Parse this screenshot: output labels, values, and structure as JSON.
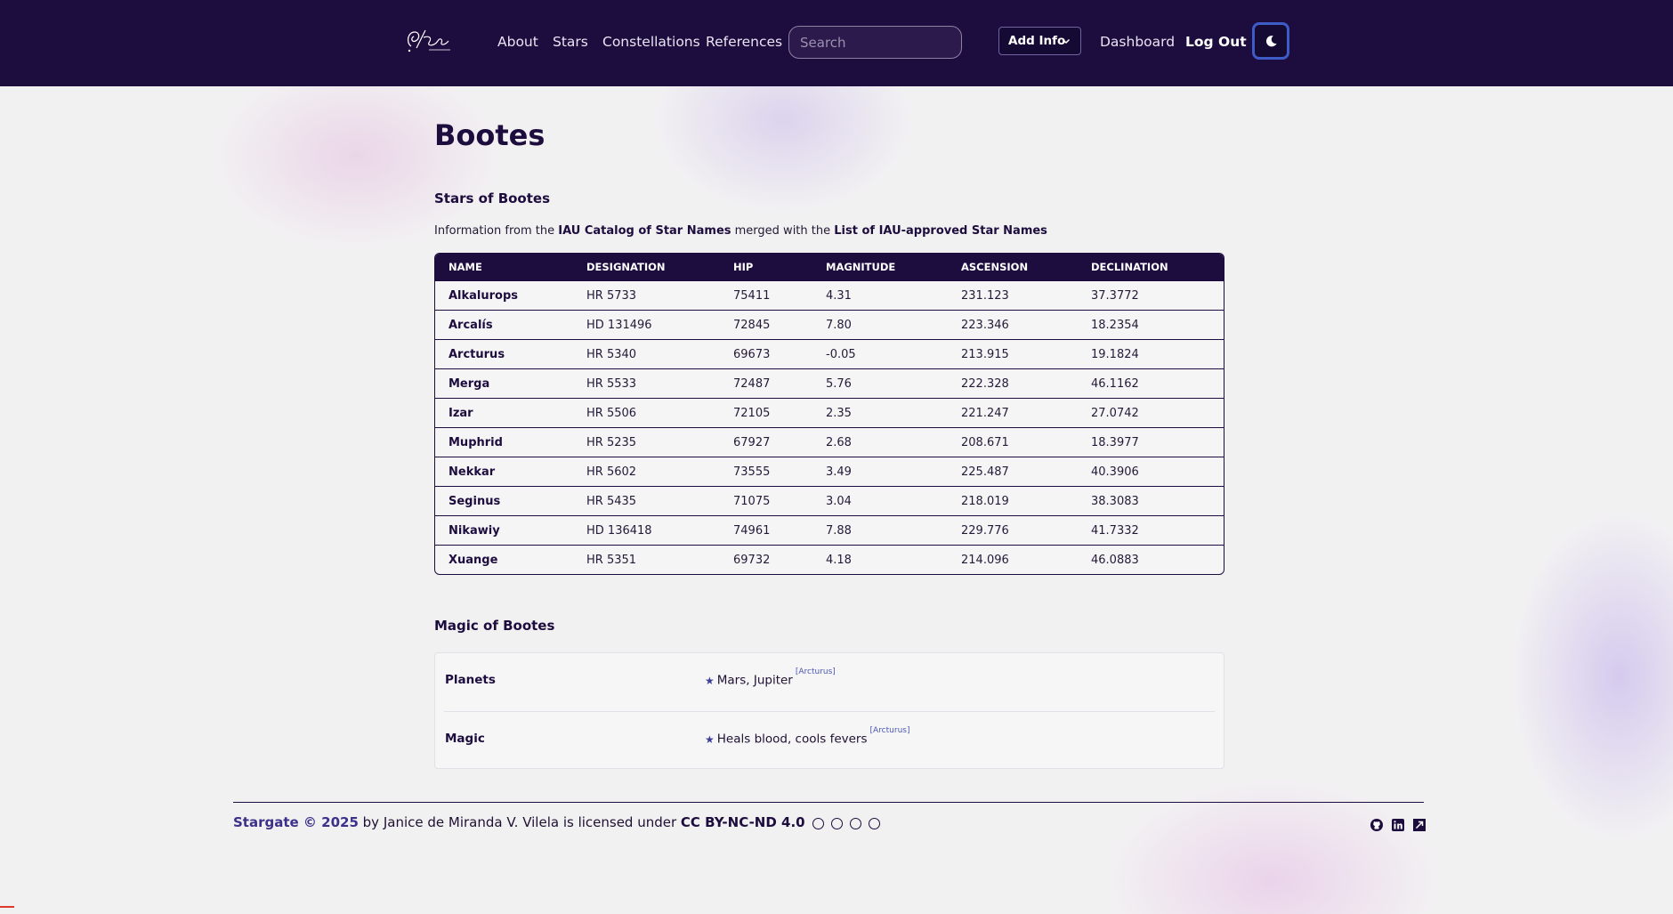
{
  "header": {
    "logo_text": "Stargate",
    "nav": [
      "About",
      "Stars",
      "Constellations",
      "References"
    ],
    "search_placeholder": "Search",
    "add_info_label": "Add Info",
    "dashboard_label": "Dashboard",
    "logout_label": "Log Out",
    "theme_icon": "moon-icon"
  },
  "main": {
    "title": "Bootes",
    "stars_heading": "Stars of Bootes",
    "intro": {
      "prefix": "Information from the ",
      "link1": "IAU Catalog of Star Names",
      "middle": " merged with the ",
      "link2": "List of IAU-approved Star Names"
    },
    "table": {
      "columns": [
        "NAME",
        "DESIGNATION",
        "HIP",
        "MAGNITUDE",
        "ASCENSION",
        "DECLINATION"
      ],
      "rows": [
        [
          "Alkalurops",
          "HR 5733",
          "75411",
          "4.31",
          "231.123",
          "37.3772"
        ],
        [
          "Arcalís",
          "HD 131496",
          "72845",
          "7.80",
          "223.346",
          "18.2354"
        ],
        [
          "Arcturus",
          "HR 5340",
          "69673",
          "-0.05",
          "213.915",
          "19.1824"
        ],
        [
          "Merga",
          "HR 5533",
          "72487",
          "5.76",
          "222.328",
          "46.1162"
        ],
        [
          "Izar",
          "HR 5506",
          "72105",
          "2.35",
          "221.247",
          "27.0742"
        ],
        [
          "Muphrid",
          "HR 5235",
          "67927",
          "2.68",
          "208.671",
          "18.3977"
        ],
        [
          "Nekkar",
          "HR 5602",
          "73555",
          "3.49",
          "225.487",
          "40.3906"
        ],
        [
          "Seginus",
          "HR 5435",
          "71075",
          "3.04",
          "218.019",
          "38.3083"
        ],
        [
          "Nikawiy",
          "HD 136418",
          "74961",
          "7.88",
          "229.776",
          "41.7332"
        ],
        [
          "Xuange",
          "HR 5351",
          "69732",
          "4.18",
          "214.096",
          "46.0883"
        ]
      ]
    },
    "magic_heading": "Magic of Bootes",
    "magic": [
      {
        "label": "Planets",
        "value": "Mars, Jupiter",
        "ref": "[Arcturus]"
      },
      {
        "label": "Magic",
        "value": "Heals blood, cools fevers",
        "ref": "[Arcturus]"
      }
    ]
  },
  "footer": {
    "site": "Stargate © 2025",
    "by": " by Janice de Miranda V. Vilela is licensed under ",
    "license": "CC BY-NC-ND 4.0",
    "license_icons": [
      "cc-icon",
      "by-icon",
      "nc-icon",
      "nd-icon"
    ],
    "social_icons": [
      "github-icon",
      "linkedin-icon",
      "external-site-icon"
    ]
  },
  "colors": {
    "header_bg": "#1d0c3e",
    "page_bg": "#f2f1f2",
    "accent": "#3b318a",
    "toggle_border": "#3d5cc7"
  }
}
